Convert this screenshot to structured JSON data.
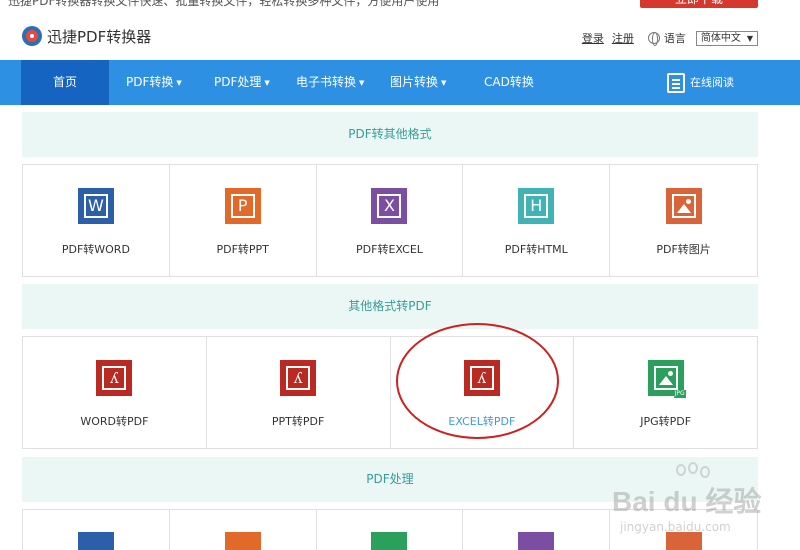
{
  "topbar": {
    "notice": "迅捷PDF转换器转换文件快速、批量转换文件，轻松转换多种文件，方便用户使用",
    "button": "立即下载"
  },
  "header": {
    "brand": "迅捷PDF转换器",
    "login": "登录",
    "register": "注册",
    "language_label": "语言",
    "language_value": "简体中文"
  },
  "nav": {
    "items": [
      "首页",
      "PDF转换",
      "PDF处理",
      "电子书转换",
      "图片转换",
      "CAD转换"
    ],
    "online_read": "在线阅读"
  },
  "sections": [
    {
      "title": "PDF转其他格式",
      "tools": [
        {
          "label": "PDF转WORD",
          "icon": "word-icon",
          "glyph": "W"
        },
        {
          "label": "PDF转PPT",
          "icon": "ppt-icon",
          "glyph": "P"
        },
        {
          "label": "PDF转EXCEL",
          "icon": "excel-icon",
          "glyph": "X"
        },
        {
          "label": "PDF转HTML",
          "icon": "html-icon",
          "glyph": "H"
        },
        {
          "label": "PDF转图片",
          "icon": "image-icon",
          "glyph": ""
        }
      ]
    },
    {
      "title": "其他格式转PDF",
      "tools": [
        {
          "label": "WORD转PDF",
          "icon": "pdf-icon",
          "glyph": "ʎ"
        },
        {
          "label": "PPT转PDF",
          "icon": "pdf-icon",
          "glyph": "ʎ"
        },
        {
          "label": "EXCEL转PDF",
          "icon": "pdf-icon",
          "glyph": "ʎ"
        },
        {
          "label": "JPG转PDF",
          "icon": "jpg-icon",
          "glyph": "",
          "tag": "JPG"
        }
      ]
    },
    {
      "title": "PDF处理"
    }
  ],
  "watermark": {
    "brand": "Bai du 经验",
    "url": "jingyan.baidu.com"
  },
  "colors": {
    "nav_bg": "#2e90e3",
    "nav_active": "#1564c2",
    "banner_bg": "#eaf7f5",
    "banner_text": "#3a9d94",
    "highlight_circle": "#cc2222"
  }
}
